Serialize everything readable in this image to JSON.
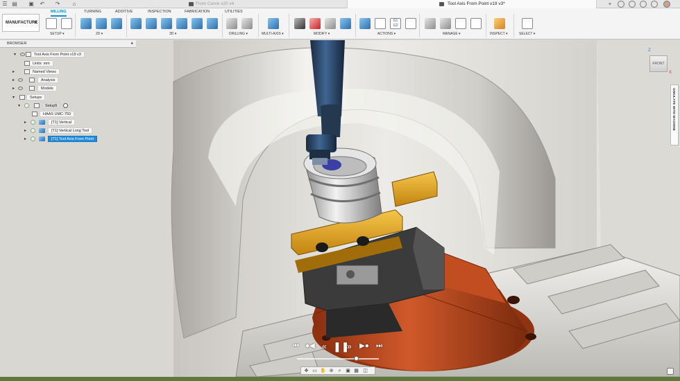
{
  "tabs": {
    "inactive_title": "From Curve v20 v4",
    "active_title": "Tool Axis From Point v19 v3*"
  },
  "ribbon": {
    "workspace": "MANUFACTURE",
    "tabs": [
      "MILLING",
      "TURNING",
      "ADDITIVE",
      "INSPECTION",
      "FABRICATION",
      "UTILITIES"
    ],
    "active_tab": "MILLING",
    "groups": [
      "SETUP",
      "2D",
      "3D",
      "DRILLING",
      "MULTI-AXIS",
      "MODIFY",
      "ACTIONS",
      "MANAGE",
      "INSPECT",
      "SELECT"
    ],
    "gcode_icon_text": "G1 G2"
  },
  "browser": {
    "title": "BROWSER",
    "items": [
      {
        "label": "Tool Axis From Point v19 v3"
      },
      {
        "label": "Units: mm"
      },
      {
        "label": "Named Views"
      },
      {
        "label": "Analysis"
      },
      {
        "label": "Models"
      },
      {
        "label": "Setups"
      },
      {
        "label": "Setup5"
      },
      {
        "label": "HAAS UMC-750"
      },
      {
        "label": "[T1] Vertical"
      },
      {
        "label": "[T1] Vertical Long Tool"
      },
      {
        "label": "[T1] Tool Axis From Point"
      }
    ],
    "selected_index": 10
  },
  "viewcube": {
    "face": "FRONT",
    "axis_z": "Z",
    "axis_x": "X"
  },
  "simulate_tab": "SIMULATE WITH MACHINE",
  "playback": {
    "progress": 0.72
  },
  "colors": {
    "accent": "#0696d7",
    "selection": "#1f8ce0",
    "vise_jaw": "#e6a317",
    "fixture_base": "#c14a1e",
    "spindle": "#2b4a6e",
    "bottom_strip": "#5d7a3b"
  }
}
